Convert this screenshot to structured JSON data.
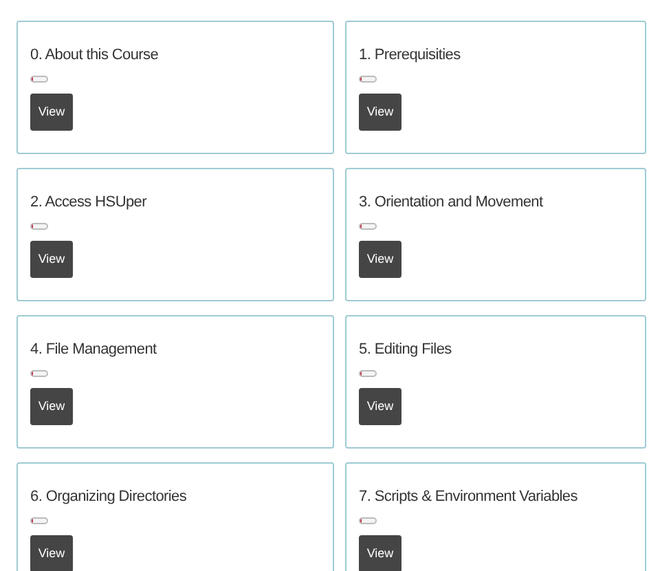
{
  "modules": [
    {
      "title": "0. About this Course",
      "level": 0.1,
      "button": "View"
    },
    {
      "title": "1. Prerequisities",
      "level": 0.1,
      "button": "View"
    },
    {
      "title": "2. Access HSUper",
      "level": 0.1,
      "button": "View"
    },
    {
      "title": "3. Orientation and Movement",
      "level": 0.1,
      "button": "View"
    },
    {
      "title": "4. File Management",
      "level": 0.1,
      "button": "View"
    },
    {
      "title": "5. Editing Files",
      "level": 0.1,
      "button": "View"
    },
    {
      "title": "6. Organizing Directories",
      "level": 0.1,
      "button": "View"
    },
    {
      "title": "7. Scripts & Environment Variables",
      "level": 0.1,
      "button": "View"
    }
  ]
}
